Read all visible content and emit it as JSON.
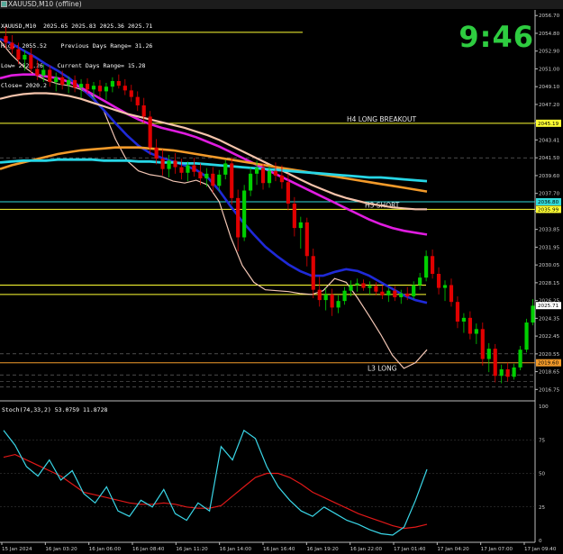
{
  "window": {
    "title": "XAUUSD,M10 (offline)",
    "clock": "9:46",
    "window_icon": "chart-window-icon"
  },
  "info_panel": {
    "symbol_line": "XAUUSD,M10  2025.65 2025.83 2025.36 2025.71",
    "high_line": "High= 2055.52    Previous Days Range= 31.26",
    "low_line": "Low= 2024.26    Current Days Range= 15.28",
    "close_line": "Close= 2020.2"
  },
  "oscillator": {
    "label": "Stoch(74,33,2) 53.0759 11.8728"
  },
  "colors": {
    "background": "#000000",
    "candle_up": "#00d000",
    "candle_down": "#e00000",
    "wick": "#ffffff",
    "ma_fast": "#f3c6b4",
    "ma_blue": "#1f2ad8",
    "ma_magenta": "#e01ce0",
    "ma_salmon": "#f4c3ab",
    "ma_cyan": "#27d6e6",
    "ma_orange": "#f29a2a",
    "level_yellow": "#ffff33",
    "level_cyan": "#33dddd",
    "stoch_main": "#3ad7e8",
    "stoch_signal": "#e01818"
  },
  "chart_data": {
    "type": "candlestick",
    "symbol": "XAUUSD",
    "timeframe": "M10",
    "ylim": [
      2016.3,
      2057.3
    ],
    "y_ticks": [
      "2056.70",
      "2054.80",
      "2052.90",
      "2051.00",
      "2049.10",
      "2047.20",
      "2045.30",
      "2043.41",
      "2041.50",
      "2039.60",
      "2037.70",
      "2035.80",
      "2033.85",
      "2031.95",
      "2030.05",
      "2028.15",
      "2026.25",
      "2024.35",
      "2022.45",
      "2020.55",
      "2018.65",
      "2016.75"
    ],
    "x_ticks": [
      "15 Jan 2024",
      "16 Jan 03:20",
      "16 Jan 06:00",
      "16 Jan 08:40",
      "16 Jan 11:20",
      "16 Jan 14:00",
      "16 Jan 16:40",
      "16 Jan 19:20",
      "16 Jan 22:00",
      "17 Jan 01:40",
      "17 Jan 04:20",
      "17 Jan 07:00",
      "17 Jan 09:40"
    ],
    "candles": [
      {
        "o": 2054.5,
        "h": 2055.5,
        "l": 2053.2,
        "c": 2053.8
      },
      {
        "o": 2053.8,
        "h": 2054.6,
        "l": 2052.6,
        "c": 2053.1
      },
      {
        "o": 2053.1,
        "h": 2053.8,
        "l": 2051.5,
        "c": 2052.0
      },
      {
        "o": 2052.0,
        "h": 2053.0,
        "l": 2050.8,
        "c": 2052.5
      },
      {
        "o": 2052.5,
        "h": 2053.2,
        "l": 2050.5,
        "c": 2051.0
      },
      {
        "o": 2051.0,
        "h": 2051.9,
        "l": 2049.8,
        "c": 2050.3
      },
      {
        "o": 2050.3,
        "h": 2051.5,
        "l": 2049.6,
        "c": 2050.9
      },
      {
        "o": 2050.9,
        "h": 2051.4,
        "l": 2049.1,
        "c": 2049.6
      },
      {
        "o": 2049.6,
        "h": 2050.6,
        "l": 2048.6,
        "c": 2050.1
      },
      {
        "o": 2050.1,
        "h": 2050.8,
        "l": 2048.8,
        "c": 2049.3
      },
      {
        "o": 2049.3,
        "h": 2050.2,
        "l": 2048.4,
        "c": 2049.8
      },
      {
        "o": 2049.8,
        "h": 2050.3,
        "l": 2048.5,
        "c": 2049.0
      },
      {
        "o": 2049.0,
        "h": 2049.9,
        "l": 2047.9,
        "c": 2049.4
      },
      {
        "o": 2049.4,
        "h": 2050.0,
        "l": 2048.3,
        "c": 2048.8
      },
      {
        "o": 2048.8,
        "h": 2049.6,
        "l": 2047.8,
        "c": 2049.2
      },
      {
        "o": 2049.2,
        "h": 2049.8,
        "l": 2048.0,
        "c": 2048.6
      },
      {
        "o": 2048.6,
        "h": 2049.5,
        "l": 2047.7,
        "c": 2049.1
      },
      {
        "o": 2049.1,
        "h": 2050.1,
        "l": 2048.5,
        "c": 2049.7
      },
      {
        "o": 2049.7,
        "h": 2050.4,
        "l": 2048.9,
        "c": 2049.2
      },
      {
        "o": 2049.2,
        "h": 2049.9,
        "l": 2048.2,
        "c": 2048.7
      },
      {
        "o": 2048.7,
        "h": 2049.3,
        "l": 2047.5,
        "c": 2048.0
      },
      {
        "o": 2048.0,
        "h": 2048.6,
        "l": 2046.5,
        "c": 2047.1
      },
      {
        "o": 2047.1,
        "h": 2047.9,
        "l": 2045.2,
        "c": 2045.9
      },
      {
        "o": 2045.9,
        "h": 2046.5,
        "l": 2041.8,
        "c": 2042.6
      },
      {
        "o": 2042.6,
        "h": 2043.5,
        "l": 2040.8,
        "c": 2041.4
      },
      {
        "o": 2041.4,
        "h": 2042.4,
        "l": 2039.6,
        "c": 2040.3
      },
      {
        "o": 2040.3,
        "h": 2041.8,
        "l": 2039.4,
        "c": 2041.2
      },
      {
        "o": 2041.2,
        "h": 2042.0,
        "l": 2039.8,
        "c": 2040.5
      },
      {
        "o": 2040.5,
        "h": 2041.4,
        "l": 2039.2,
        "c": 2039.9
      },
      {
        "o": 2039.9,
        "h": 2041.1,
        "l": 2039.0,
        "c": 2040.7
      },
      {
        "o": 2040.7,
        "h": 2041.5,
        "l": 2039.5,
        "c": 2040.0
      },
      {
        "o": 2040.0,
        "h": 2040.9,
        "l": 2038.6,
        "c": 2039.3
      },
      {
        "o": 2039.3,
        "h": 2040.4,
        "l": 2038.4,
        "c": 2039.8
      },
      {
        "o": 2039.8,
        "h": 2040.5,
        "l": 2037.8,
        "c": 2038.5
      },
      {
        "o": 2038.5,
        "h": 2040.2,
        "l": 2037.9,
        "c": 2039.7
      },
      {
        "o": 2039.7,
        "h": 2041.3,
        "l": 2039.2,
        "c": 2040.9
      },
      {
        "o": 2040.9,
        "h": 2041.6,
        "l": 2036.5,
        "c": 2037.2
      },
      {
        "o": 2037.2,
        "h": 2038.1,
        "l": 2031.5,
        "c": 2033.0
      },
      {
        "o": 2033.0,
        "h": 2038.6,
        "l": 2032.6,
        "c": 2038.0
      },
      {
        "o": 2038.0,
        "h": 2040.5,
        "l": 2037.4,
        "c": 2039.8
      },
      {
        "o": 2039.8,
        "h": 2041.2,
        "l": 2038.6,
        "c": 2040.4
      },
      {
        "o": 2040.4,
        "h": 2040.9,
        "l": 2038.1,
        "c": 2038.8
      },
      {
        "o": 2038.8,
        "h": 2040.6,
        "l": 2038.3,
        "c": 2040.1
      },
      {
        "o": 2040.1,
        "h": 2041.0,
        "l": 2039.0,
        "c": 2039.6
      },
      {
        "o": 2039.6,
        "h": 2040.7,
        "l": 2038.2,
        "c": 2038.9
      },
      {
        "o": 2038.9,
        "h": 2039.8,
        "l": 2035.9,
        "c": 2036.6
      },
      {
        "o": 2036.6,
        "h": 2037.3,
        "l": 2033.1,
        "c": 2034.0
      },
      {
        "o": 2034.0,
        "h": 2035.2,
        "l": 2031.8,
        "c": 2034.6
      },
      {
        "o": 2034.6,
        "h": 2035.1,
        "l": 2029.9,
        "c": 2031.0
      },
      {
        "o": 2031.0,
        "h": 2031.8,
        "l": 2026.5,
        "c": 2027.4
      },
      {
        "o": 2027.4,
        "h": 2028.8,
        "l": 2025.6,
        "c": 2026.3
      },
      {
        "o": 2026.3,
        "h": 2027.6,
        "l": 2025.2,
        "c": 2026.9
      },
      {
        "o": 2026.9,
        "h": 2027.5,
        "l": 2024.6,
        "c": 2025.5
      },
      {
        "o": 2025.5,
        "h": 2026.8,
        "l": 2024.9,
        "c": 2026.2
      },
      {
        "o": 2026.2,
        "h": 2027.7,
        "l": 2025.8,
        "c": 2027.3
      },
      {
        "o": 2027.3,
        "h": 2028.4,
        "l": 2026.7,
        "c": 2027.9
      },
      {
        "o": 2027.9,
        "h": 2028.6,
        "l": 2027.2,
        "c": 2028.1
      },
      {
        "o": 2028.1,
        "h": 2028.5,
        "l": 2027.3,
        "c": 2027.6
      },
      {
        "o": 2027.6,
        "h": 2028.3,
        "l": 2026.9,
        "c": 2027.8
      },
      {
        "o": 2027.8,
        "h": 2028.2,
        "l": 2026.8,
        "c": 2027.2
      },
      {
        "o": 2027.2,
        "h": 2027.9,
        "l": 2026.4,
        "c": 2026.8
      },
      {
        "o": 2026.8,
        "h": 2027.6,
        "l": 2026.1,
        "c": 2027.3
      },
      {
        "o": 2027.3,
        "h": 2027.8,
        "l": 2026.2,
        "c": 2026.6
      },
      {
        "o": 2026.6,
        "h": 2027.4,
        "l": 2025.9,
        "c": 2027.0
      },
      {
        "o": 2027.0,
        "h": 2027.7,
        "l": 2026.3,
        "c": 2026.7
      },
      {
        "o": 2026.7,
        "h": 2028.3,
        "l": 2026.4,
        "c": 2027.9
      },
      {
        "o": 2027.9,
        "h": 2029.2,
        "l": 2027.4,
        "c": 2028.7
      },
      {
        "o": 2028.7,
        "h": 2031.6,
        "l": 2028.3,
        "c": 2031.0
      },
      {
        "o": 2031.0,
        "h": 2031.7,
        "l": 2028.6,
        "c": 2029.1
      },
      {
        "o": 2029.1,
        "h": 2029.8,
        "l": 2026.9,
        "c": 2027.6
      },
      {
        "o": 2027.6,
        "h": 2028.4,
        "l": 2026.2,
        "c": 2027.9
      },
      {
        "o": 2027.9,
        "h": 2028.6,
        "l": 2025.6,
        "c": 2026.1
      },
      {
        "o": 2026.1,
        "h": 2026.7,
        "l": 2023.3,
        "c": 2024.0
      },
      {
        "o": 2024.0,
        "h": 2024.9,
        "l": 2022.8,
        "c": 2024.4
      },
      {
        "o": 2024.4,
        "h": 2025.1,
        "l": 2022.1,
        "c": 2022.7
      },
      {
        "o": 2022.7,
        "h": 2023.8,
        "l": 2021.6,
        "c": 2023.2
      },
      {
        "o": 2023.2,
        "h": 2023.9,
        "l": 2019.3,
        "c": 2020.0
      },
      {
        "o": 2020.0,
        "h": 2021.7,
        "l": 2018.6,
        "c": 2021.1
      },
      {
        "o": 2021.1,
        "h": 2021.6,
        "l": 2017.5,
        "c": 2018.2
      },
      {
        "o": 2018.2,
        "h": 2019.4,
        "l": 2017.4,
        "c": 2018.9
      },
      {
        "o": 2018.9,
        "h": 2019.6,
        "l": 2017.6,
        "c": 2018.1
      },
      {
        "o": 2018.1,
        "h": 2019.5,
        "l": 2017.8,
        "c": 2019.1
      },
      {
        "o": 2019.1,
        "h": 2021.4,
        "l": 2018.8,
        "c": 2021.0
      },
      {
        "o": 2021.0,
        "h": 2024.3,
        "l": 2020.7,
        "c": 2023.9
      },
      {
        "o": 2023.9,
        "h": 2026.4,
        "l": 2023.6,
        "c": 2025.7
      }
    ],
    "moving_averages": [
      {
        "color_key": "ma_fast",
        "values": [
          2054.0,
          2052.5,
          2051.3,
          2050.4,
          2049.8,
          2049.4,
          2049.2,
          2048.8,
          2048.1,
          2046.5,
          2043.5,
          2041.2,
          2040.1,
          2039.7,
          2039.5,
          2039.0,
          2038.8,
          2039.1,
          2038.6,
          2036.8,
          2033.0,
          2030.0,
          2028.2,
          2027.4,
          2027.3,
          2027.2,
          2027.0,
          2026.9,
          2027.3,
          2028.6,
          2028.2,
          2026.5,
          2024.6,
          2022.6,
          2020.4,
          2019.0,
          2019.6,
          2021.0
        ]
      },
      {
        "color_key": "ma_blue",
        "values": [
          2054.2,
          2053.7,
          2053.0,
          2052.3,
          2051.5,
          2050.8,
          2050.0,
          2049.0,
          2047.9,
          2046.6,
          2045.2,
          2043.9,
          2042.8,
          2042.0,
          2041.5,
          2041.1,
          2040.7,
          2040.2,
          2039.4,
          2038.0,
          2036.3,
          2034.7,
          2033.3,
          2032.0,
          2031.0,
          2030.1,
          2029.4,
          2028.9,
          2028.9,
          2029.3,
          2029.6,
          2029.4,
          2028.9,
          2028.2,
          2027.5,
          2026.8,
          2026.3,
          2026.0
        ]
      },
      {
        "color_key": "ma_magenta",
        "values": [
          2050.0,
          2050.3,
          2050.4,
          2050.4,
          2050.2,
          2050.0,
          2049.6,
          2049.0,
          2048.3,
          2047.6,
          2046.9,
          2046.2,
          2045.6,
          2045.1,
          2044.7,
          2044.4,
          2044.1,
          2043.7,
          2043.2,
          2042.7,
          2042.1,
          2041.5,
          2040.9,
          2040.3,
          2039.7,
          2039.1,
          2038.5,
          2037.9,
          2037.3,
          2036.7,
          2036.1,
          2035.5,
          2034.9,
          2034.4,
          2034.0,
          2033.7,
          2033.5,
          2033.3
        ]
      },
      {
        "color_key": "ma_salmon",
        "values": [
          2047.8,
          2048.1,
          2048.3,
          2048.4,
          2048.4,
          2048.3,
          2048.1,
          2047.8,
          2047.4,
          2047.0,
          2046.6,
          2046.2,
          2045.9,
          2045.6,
          2045.3,
          2045.0,
          2044.7,
          2044.3,
          2043.9,
          2043.4,
          2042.8,
          2042.2,
          2041.6,
          2041.0,
          2040.4,
          2039.8,
          2039.2,
          2038.6,
          2038.1,
          2037.6,
          2037.2,
          2036.9,
          2036.6,
          2036.4,
          2036.2,
          2036.1,
          2036.0,
          2036.0
        ]
      },
      {
        "color_key": "ma_orange",
        "values": [
          2040.3,
          2040.7,
          2041.0,
          2041.3,
          2041.6,
          2041.9,
          2042.1,
          2042.3,
          2042.4,
          2042.5,
          2042.6,
          2042.6,
          2042.6,
          2042.5,
          2042.4,
          2042.3,
          2042.1,
          2041.9,
          2041.7,
          2041.5,
          2041.3,
          2041.1,
          2040.9,
          2040.7,
          2040.5,
          2040.3,
          2040.1,
          2039.9,
          2039.7,
          2039.5,
          2039.3,
          2039.1,
          2038.9,
          2038.7,
          2038.5,
          2038.3,
          2038.1,
          2037.9
        ]
      },
      {
        "color_key": "ma_cyan",
        "values": [
          2041.0,
          2041.1,
          2041.2,
          2041.2,
          2041.2,
          2041.3,
          2041.3,
          2041.3,
          2041.3,
          2041.2,
          2041.2,
          2041.2,
          2041.1,
          2041.1,
          2041.0,
          2041.0,
          2040.9,
          2040.9,
          2040.8,
          2040.7,
          2040.6,
          2040.5,
          2040.4,
          2040.3,
          2040.2,
          2040.1,
          2040.0,
          2039.9,
          2039.8,
          2039.7,
          2039.6,
          2039.5,
          2039.4,
          2039.4,
          2039.3,
          2039.2,
          2039.1,
          2039.0
        ]
      }
    ],
    "horizontal_levels": [
      {
        "value": 2054.9,
        "color_key": "level_yellow",
        "label": "",
        "price_tag": ""
      },
      {
        "value": 2045.19,
        "color_key": "level_yellow",
        "label": "H4 LONG BREAKOUT",
        "price_tag": "2045.19"
      },
      {
        "value": 2036.8,
        "color_key": "level_cyan",
        "label": "",
        "price_tag": "2036.80"
      },
      {
        "value": 2035.99,
        "color_key": "level_yellow",
        "label": "H3 SHORT",
        "price_tag": "2035.99"
      },
      {
        "value": 2027.9,
        "color_key": "level_yellow",
        "label": "",
        "price_tag": ""
      },
      {
        "value": 2026.9,
        "color_key": "level_yellow",
        "label": "",
        "price_tag": ""
      },
      {
        "value": 2019.6,
        "color_key": "ma_orange",
        "label": "L3 LONG",
        "price_tag": "2019.60"
      }
    ],
    "current_price": "2025.71",
    "stochastic": {
      "name": "Stoch(74,33,2)",
      "ylim": [
        0,
        100
      ],
      "y_ticks": [
        "100",
        "75",
        "50",
        "25",
        "0"
      ],
      "main": [
        82,
        71,
        55,
        48,
        60,
        45,
        52,
        35,
        28,
        40,
        22,
        18,
        30,
        25,
        38,
        20,
        15,
        28,
        22,
        70,
        60,
        82,
        76,
        55,
        40,
        30,
        22,
        18,
        25,
        20,
        15,
        12,
        8,
        5,
        4,
        10,
        30,
        53
      ],
      "signal": [
        62,
        64,
        60,
        56,
        52,
        48,
        42,
        36,
        34,
        32,
        30,
        28,
        27,
        27,
        28,
        27,
        25,
        24,
        24,
        26,
        33,
        40,
        47,
        50,
        50,
        47,
        42,
        36,
        32,
        28,
        24,
        20,
        17,
        14,
        11,
        9,
        10,
        12
      ]
    }
  }
}
